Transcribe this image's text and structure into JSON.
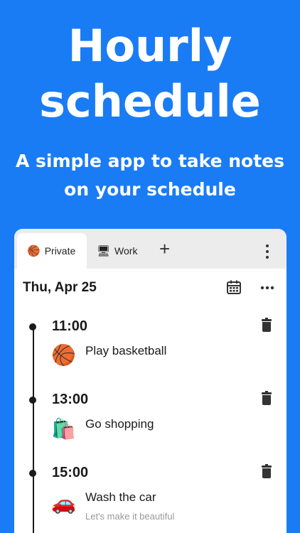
{
  "hero": {
    "title_line1": "Hourly",
    "title_line2": "schedule",
    "subtitle_line1": "A simple app to take notes",
    "subtitle_line2": "on your schedule"
  },
  "tabs": [
    {
      "icon": "🏀",
      "label": "Private",
      "active": true
    },
    {
      "icon": "🖥",
      "label": "Work",
      "active": false
    }
  ],
  "tab_add": "+",
  "date": "Thu, Apr 25",
  "entries": [
    {
      "time": "11:00",
      "emoji": "🏀",
      "note": "Play basketball",
      "subnote": ""
    },
    {
      "time": "13:00",
      "emoji": "🛍️",
      "note": "Go shopping",
      "subnote": ""
    },
    {
      "time": "15:00",
      "emoji": "🚗",
      "note": "Wash the car",
      "subnote": "Let's make it beautiful"
    }
  ],
  "colors": {
    "background": "#1a7cf5",
    "card": "#ffffff",
    "tabbar": "#ececec"
  }
}
